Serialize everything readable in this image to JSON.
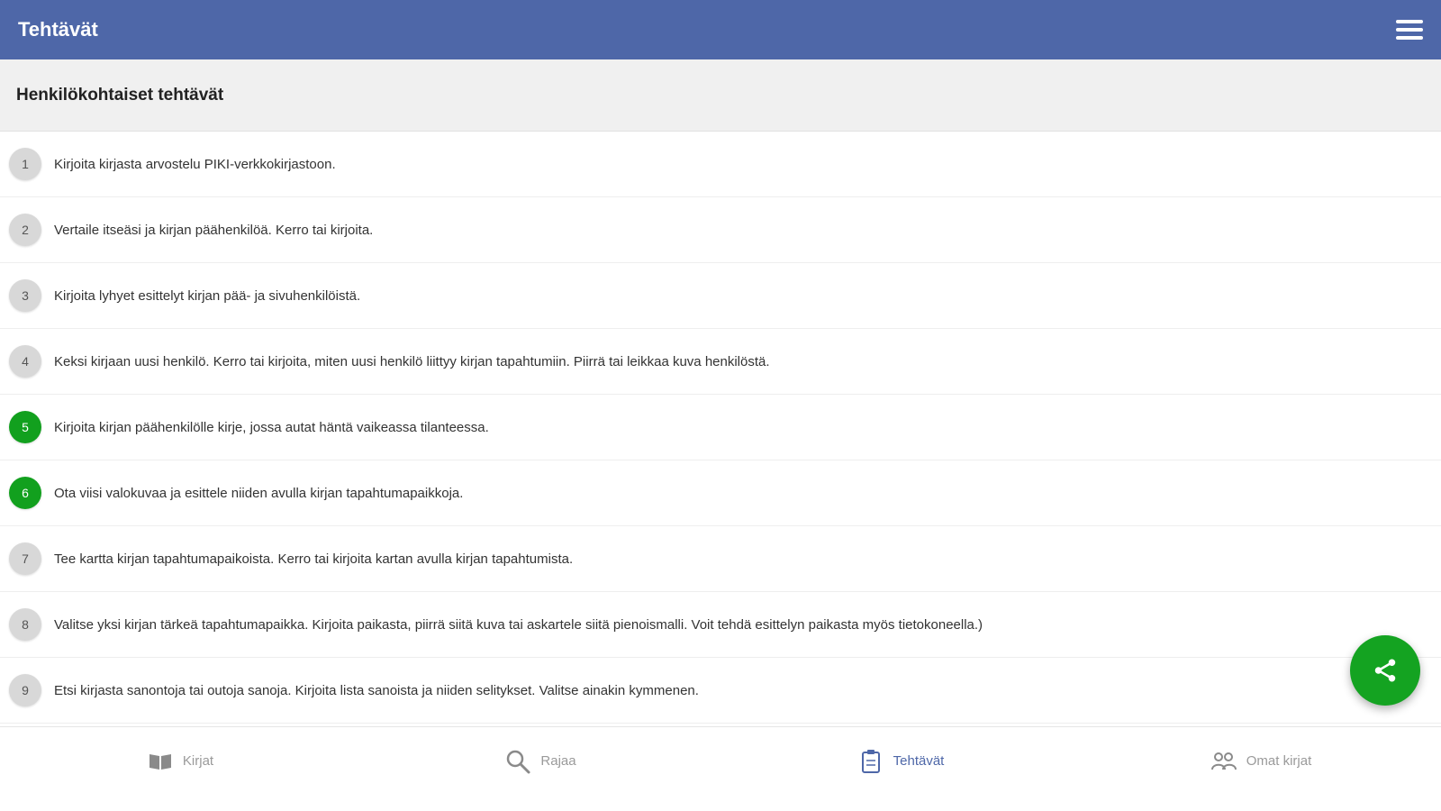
{
  "appbar": {
    "title": "Tehtävät",
    "menu_icon": "hamburger-menu-icon"
  },
  "section": {
    "title": "Henkilökohtaiset tehtävät"
  },
  "tasks": [
    {
      "number": "1",
      "text": "Kirjoita kirjasta arvostelu PIKI-verkkokirjastoon.",
      "done": false
    },
    {
      "number": "2",
      "text": "Vertaile itseäsi ja kirjan päähenkilöä. Kerro tai kirjoita.",
      "done": false
    },
    {
      "number": "3",
      "text": "Kirjoita lyhyet esittelyt kirjan pää- ja sivuhenkilöistä.",
      "done": false
    },
    {
      "number": "4",
      "text": "Keksi kirjaan uusi henkilö. Kerro tai kirjoita, miten uusi henkilö liittyy kirjan tapahtumiin. Piirrä tai leikkaa kuva henkilöstä.",
      "done": false
    },
    {
      "number": "5",
      "text": "Kirjoita kirjan päähenkilölle kirje, jossa autat häntä vaikeassa tilanteessa.",
      "done": true
    },
    {
      "number": "6",
      "text": "Ota viisi valokuvaa ja esittele niiden avulla kirjan tapahtumapaikkoja.",
      "done": true
    },
    {
      "number": "7",
      "text": "Tee kartta kirjan tapahtumapaikoista. Kerro tai kirjoita kartan avulla kirjan tapahtumista.",
      "done": false
    },
    {
      "number": "8",
      "text": "Valitse yksi kirjan tärkeä tapahtumapaikka. Kirjoita paikasta, piirrä siitä kuva tai askartele siitä pienoismalli. Voit tehdä esittelyn paikasta myös tietokoneella.)",
      "done": false
    },
    {
      "number": "9",
      "text": "Etsi kirjasta sanontoja tai outoja sanoja. Kirjoita lista sanoista ja niiden selitykset. Valitse ainakin kymmenen.",
      "done": false
    }
  ],
  "fab": {
    "icon": "share-icon"
  },
  "bottom_nav": {
    "items": [
      {
        "label": "Kirjat",
        "icon": "book-icon",
        "active": false
      },
      {
        "label": "Rajaa",
        "icon": "search-icon",
        "active": false
      },
      {
        "label": "Tehtävät",
        "icon": "clipboard-icon",
        "active": true
      },
      {
        "label": "Omat kirjat",
        "icon": "people-icon",
        "active": false
      }
    ]
  },
  "colors": {
    "primary": "#4e67a8",
    "done": "#12a01e",
    "fab": "#14a321",
    "pending": "#d8d8d8",
    "inactive_nav": "#9a9a9a"
  }
}
